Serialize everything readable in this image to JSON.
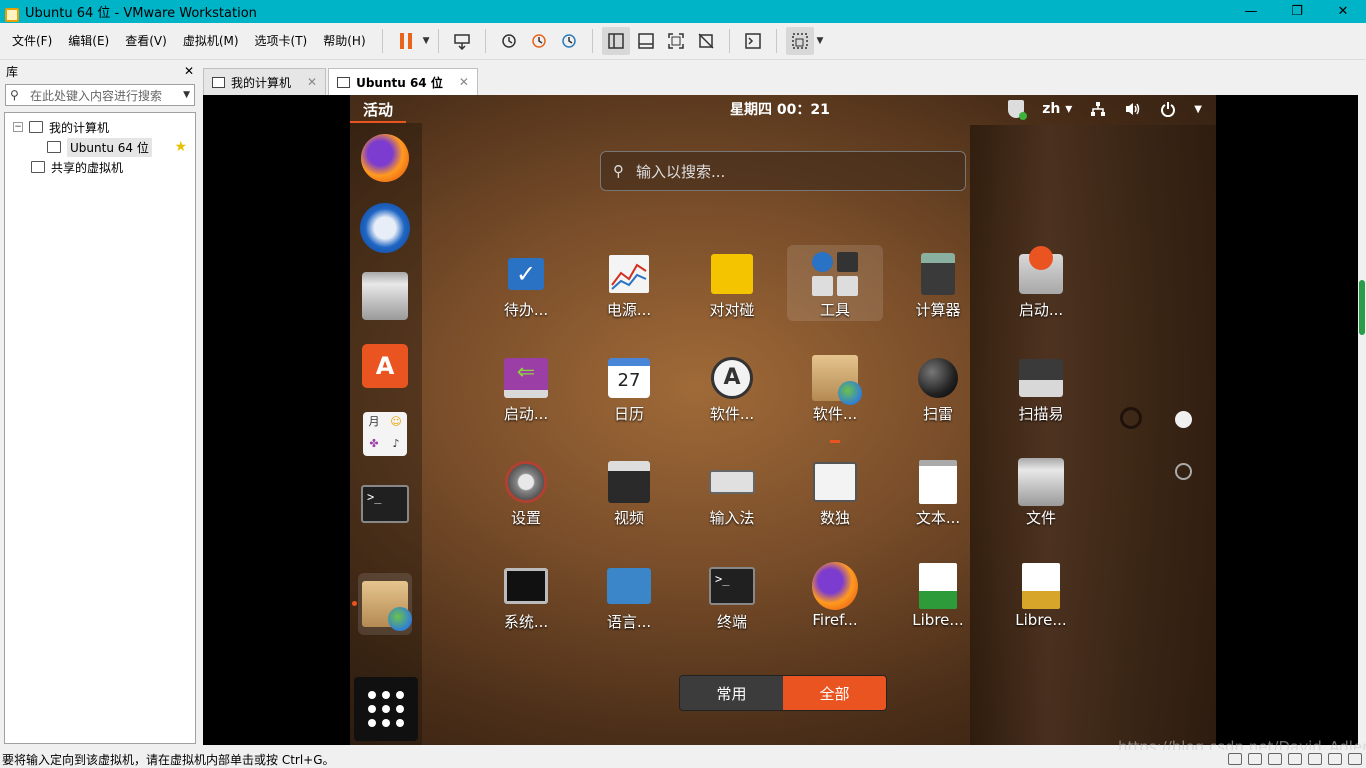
{
  "window": {
    "title": "Ubuntu 64 位 - VMware Workstation",
    "controls": {
      "minimize": "—",
      "restore": "❐",
      "close": "✕"
    }
  },
  "menu": [
    "文件(F)",
    "编辑(E)",
    "查看(V)",
    "虚拟机(M)",
    "选项卡(T)",
    "帮助(H)"
  ],
  "library": {
    "title": "库",
    "close": "✕",
    "search_placeholder": "在此处键入内容进行搜索",
    "tree": {
      "my_computer": "我的计算机",
      "vm": "Ubuntu 64 位",
      "shared": "共享的虚拟机"
    }
  },
  "tabs": [
    {
      "label": "我的计算机",
      "close": "✕"
    },
    {
      "label": "Ubuntu 64 位",
      "close": "✕"
    }
  ],
  "ubuntu": {
    "activities": "活动",
    "clock": "星期四 00：21",
    "input_method": "zh ▾",
    "search_placeholder": "输入以搜索...",
    "apps": [
      "待办...",
      "电源...",
      "对对碰",
      "工具",
      "计算器",
      "启动...",
      "启动...",
      "日历",
      "软件...",
      "软件...",
      "扫雷",
      "扫描易",
      "设置",
      "视频",
      "输入法",
      "数独",
      "文本...",
      "文件",
      "系统...",
      "语言...",
      "终端",
      "Firef...",
      "Libre...",
      "Libre..."
    ],
    "calendar_day": "27",
    "tab_frequent": "常用",
    "tab_all": "全部"
  },
  "status": {
    "message": "要将输入定向到该虚拟机，请在虚拟机内部单击或按 Ctrl+G。",
    "watermark": "https://blog.csdn.net/David_Adler"
  },
  "colors": {
    "titlebar": "#00b4c8",
    "ubuntu_accent": "#e95420",
    "pause": "#e8631c"
  },
  "icons": [
    "pause-icon",
    "send-ctrl-alt-del-icon",
    "snapshot-icon",
    "revert-snapshot-icon",
    "snapshot-manager-icon",
    "library-view-icon",
    "thumbnail-view-icon",
    "fullscreen-icon",
    "unity-icon",
    "console-icon",
    "autofit-icon"
  ]
}
